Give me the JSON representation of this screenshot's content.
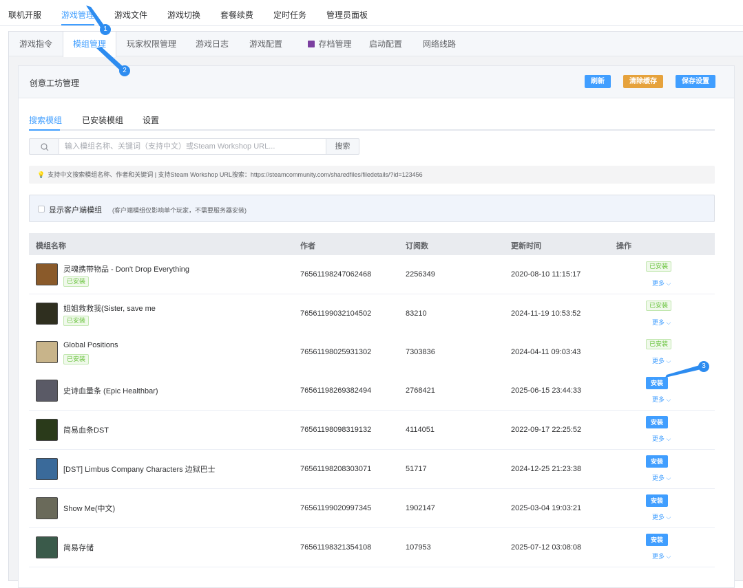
{
  "topnav": {
    "items": [
      "联机开服",
      "游戏管理",
      "游戏文件",
      "游戏切换",
      "套餐续费",
      "定时任务",
      "管理员面板"
    ],
    "active_index": 1
  },
  "subtabs": {
    "items": [
      "游戏指令",
      "模组管理",
      "玩家权限管理",
      "游戏日志",
      "游戏配置",
      "存档管理",
      "启动配置",
      "网络线路"
    ],
    "active_index": 1
  },
  "card": {
    "title": "创意工坊管理",
    "refresh_label": "刷新",
    "clear_cache_label": "清除缓存",
    "save_settings_label": "保存设置"
  },
  "inner_tabs": {
    "items": [
      "搜索模组",
      "已安装模组",
      "设置"
    ],
    "active_index": 0
  },
  "search": {
    "placeholder": "输入模组名称、关键词（支持中文）或Steam Workshop URL...",
    "value": "",
    "button_label": "搜索"
  },
  "tip": "支持中文搜索模组名称、作者和关键词 | 支持Steam Workshop URL搜索：https://steamcommunity.com/sharedfiles/filedetails/?id=123456",
  "client_mods": {
    "label": "显示客户端模组",
    "hint": "(客户端模组仅影响单个玩家，不需要服务器安装)",
    "checked": false
  },
  "table": {
    "headers": [
      "模组名称",
      "作者",
      "订阅数",
      "更新时间",
      "操作"
    ],
    "installed_badge": "已安装",
    "install_label": "安装",
    "more_label": "更多 ⌵",
    "rows": [
      {
        "name": "灵魂携带物品 - Don't Drop Everything",
        "author": "76561198247062468",
        "subs": "2256349",
        "updated": "2020-08-10 11:15:17",
        "installed": true,
        "thumb_color": "#8a5a2a"
      },
      {
        "name": "姐姐救救我(Sister, save me",
        "author": "76561199032104502",
        "subs": "83210",
        "updated": "2024-11-19 10:53:52",
        "installed": true,
        "thumb_color": "#2f2f1f"
      },
      {
        "name": "Global Positions",
        "author": "76561198025931302",
        "subs": "7303836",
        "updated": "2024-04-11 09:03:43",
        "installed": true,
        "thumb_color": "#c8b48a"
      },
      {
        "name": "史诗血量条 (Epic Healthbar)",
        "author": "76561198269382494",
        "subs": "2768421",
        "updated": "2025-06-15 23:44:33",
        "installed": false,
        "thumb_color": "#5a5a66"
      },
      {
        "name": "简易血条DST",
        "author": "76561198098319132",
        "subs": "4114051",
        "updated": "2022-09-17 22:25:52",
        "installed": false,
        "thumb_color": "#2a3a1a"
      },
      {
        "name": "[DST] Limbus Company Characters 边狱巴士",
        "author": "76561198208303071",
        "subs": "51717",
        "updated": "2024-12-25 21:23:38",
        "installed": false,
        "thumb_color": "#3a6a9a"
      },
      {
        "name": "Show Me(中文)",
        "author": "76561199020997345",
        "subs": "1902147",
        "updated": "2025-03-04 19:03:21",
        "installed": false,
        "thumb_color": "#6a6a5a"
      },
      {
        "name": "简易存储",
        "author": "76561198321354108",
        "subs": "107953",
        "updated": "2025-07-12 03:08:08",
        "installed": false,
        "thumb_color": "#3a5a4a"
      }
    ]
  },
  "callouts": [
    "1",
    "2",
    "3"
  ],
  "colors": {
    "accent": "#409eff",
    "warning": "#e6a23c",
    "success": "#67c23a",
    "callout": "#2d8cf0"
  }
}
